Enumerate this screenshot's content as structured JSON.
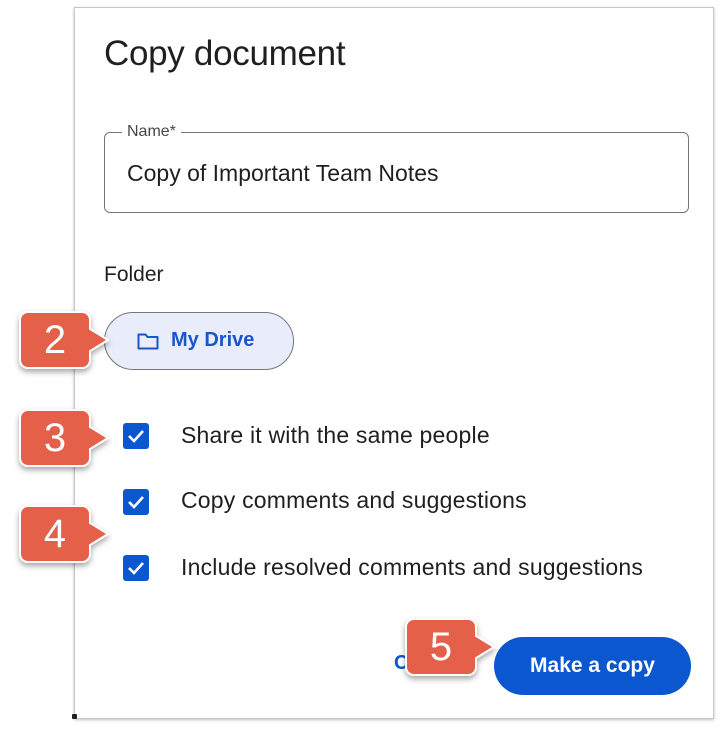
{
  "dialog": {
    "title": "Copy document",
    "name_field": {
      "label": "Name*",
      "value": "Copy of Important Team Notes"
    },
    "folder": {
      "label": "Folder",
      "chip_label": "My Drive",
      "chip_icon": "folder-icon"
    },
    "options": [
      {
        "label": "Share it with the same people",
        "checked": true
      },
      {
        "label": "Copy comments and suggestions",
        "checked": true
      },
      {
        "label": "Include resolved comments and suggestions",
        "checked": true
      }
    ],
    "buttons": {
      "cancel": "Cancel",
      "make_copy": "Make a copy"
    }
  },
  "callouts": [
    "2",
    "3",
    "4",
    "5"
  ],
  "colors": {
    "accent": "#0b57d0",
    "chip_bg": "#e8ecfb",
    "callout": "#e4614a"
  }
}
